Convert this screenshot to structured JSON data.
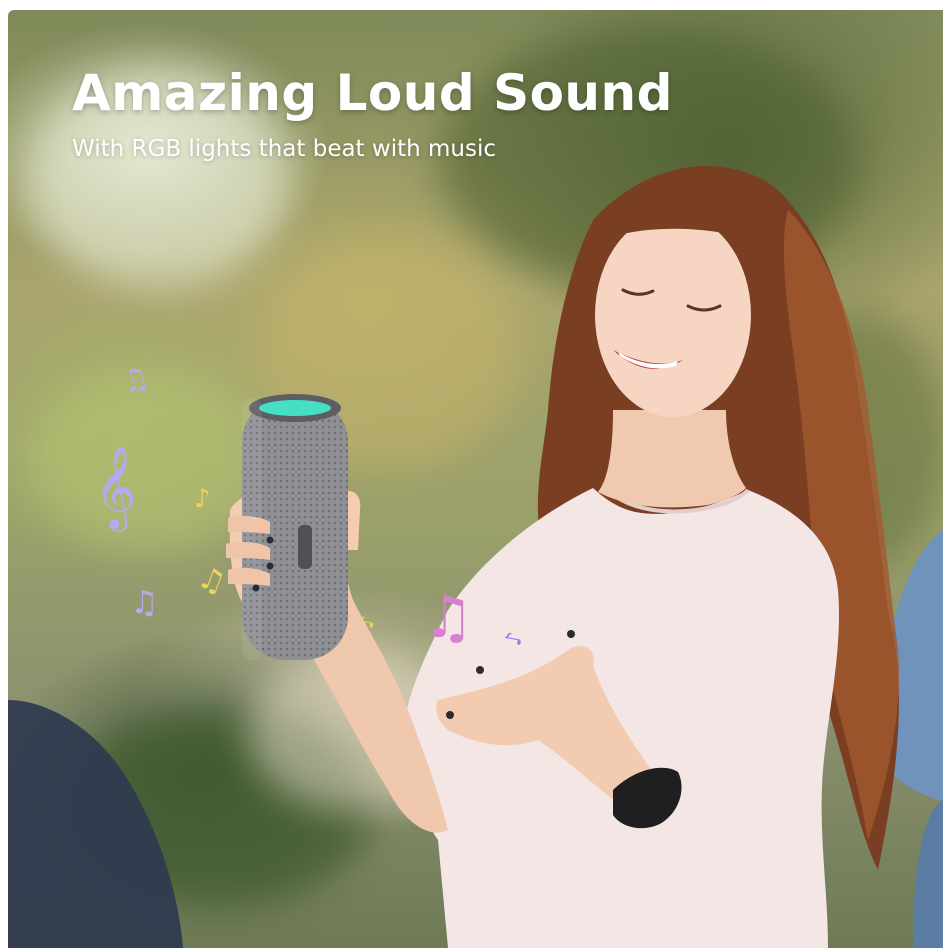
{
  "banner": {
    "headline": "Amazing Loud Sound",
    "subheadline": "With RGB lights that beat with music"
  },
  "photo": {
    "scene": "woman-holding-speaker"
  },
  "music_notes": {
    "color_primary": "#b7a8f0",
    "color_accent": "#f0d35a"
  },
  "colors": {
    "text": "#ffffff",
    "speaker_glow": "#46e6c8"
  }
}
